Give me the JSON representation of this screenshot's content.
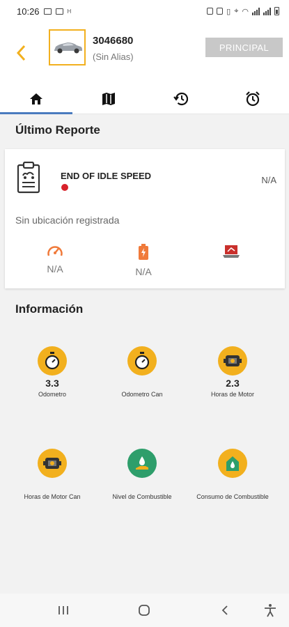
{
  "status_bar": {
    "time": "10:26",
    "carrier_mark": "H"
  },
  "header": {
    "vehicle_id": "3046680",
    "alias": "(Sin Alias)",
    "principal_label": "PRINCIPAL"
  },
  "tabs": [
    {
      "icon": "home-icon",
      "active": true
    },
    {
      "icon": "map-icon",
      "active": false
    },
    {
      "icon": "history-icon",
      "active": false
    },
    {
      "icon": "alarm-clock-icon",
      "active": false
    }
  ],
  "last_report": {
    "title": "Último Reporte",
    "event": "END OF IDLE SPEED",
    "status_color": "#d8212a",
    "value": "N/A",
    "location": "Sin ubicación registrada",
    "metrics": [
      {
        "icon": "speedometer-icon",
        "value": "N/A"
      },
      {
        "icon": "battery-icon",
        "value": "N/A"
      },
      {
        "icon": "laptop-icon",
        "value": ""
      }
    ]
  },
  "information": {
    "title": "Información",
    "items": [
      {
        "icon": "stopwatch-icon",
        "value": "3.3",
        "label": "Odometro"
      },
      {
        "icon": "stopwatch-icon",
        "value": "",
        "label": "Odometro Can"
      },
      {
        "icon": "engine-icon",
        "value": "2.3",
        "label": "Horas de Motor"
      },
      {
        "icon": "engine-icon",
        "value": "",
        "label": "Horas de Motor Can"
      },
      {
        "icon": "fuel-level-icon",
        "value": "",
        "label": "Nivel de Combustible"
      },
      {
        "icon": "fuel-consumption-icon",
        "value": "",
        "label": "Consumo de Combustible"
      }
    ]
  },
  "colors": {
    "accent": "#f2b01e",
    "tab_indicator": "#4a7bbf",
    "button_disabled": "#c8c8c8",
    "fuel_green": "#2e9e6b",
    "metric_orange": "#f07a3a"
  }
}
